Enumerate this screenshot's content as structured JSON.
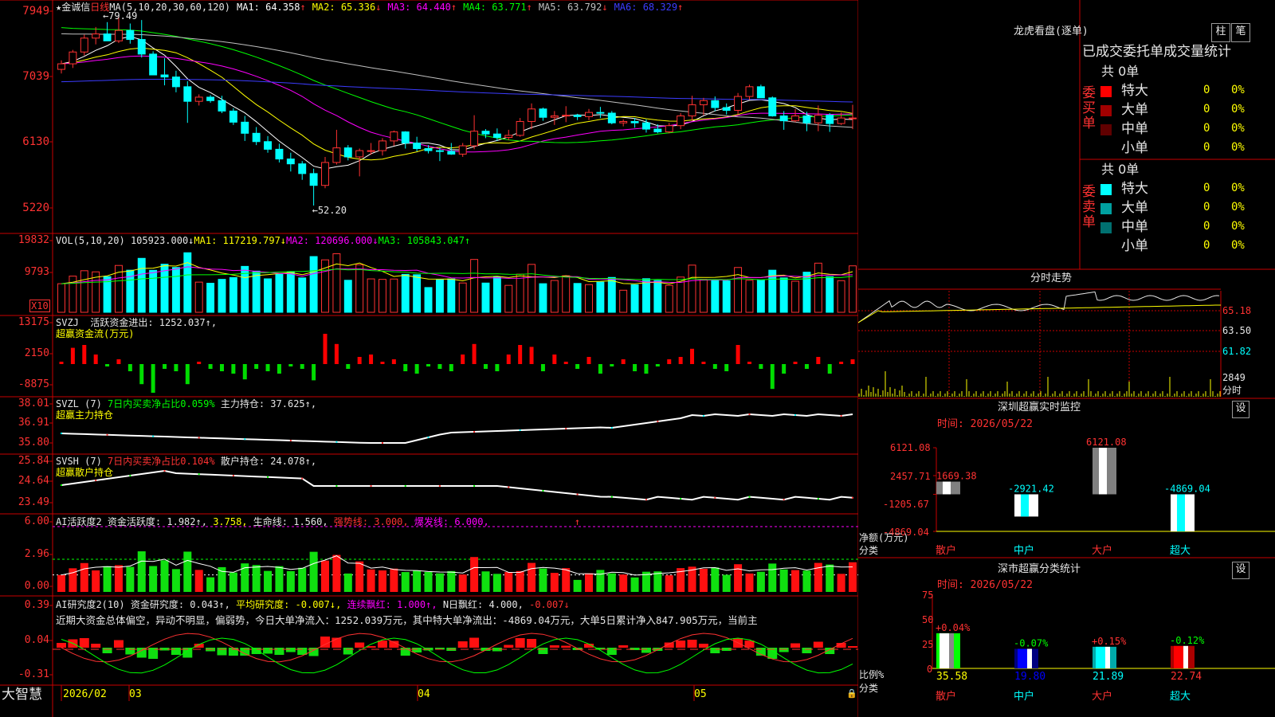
{
  "stock": {
    "star": "★",
    "name": "金诚信",
    "period": "日线"
  },
  "price_panel": {
    "ma_title": "MA(5,10,20,30,60,120)",
    "ma_items": [
      {
        "label": "MA1:",
        "value": "64.358",
        "arrow": "↑",
        "color": "#ffffff"
      },
      {
        "label": "MA2:",
        "value": "65.336",
        "arrow": "↓",
        "color": "#ffff00"
      },
      {
        "label": "MA3:",
        "value": "64.440",
        "arrow": "↑",
        "color": "#ff00ff"
      },
      {
        "label": "MA4:",
        "value": "63.771",
        "arrow": "↑",
        "color": "#00ff00"
      },
      {
        "label": "MA5:",
        "value": "63.792",
        "arrow": "↓",
        "color": "#c0c0c0"
      },
      {
        "label": "MA6:",
        "value": "68.329",
        "arrow": "↑",
        "color": "#3c3cff"
      }
    ],
    "yticks": [
      "7949",
      "7039",
      "6130",
      "5220"
    ],
    "high_label": "←79.49",
    "low_label": "←52.20"
  },
  "vol_panel": {
    "title": "VOL(5,10,20)",
    "value": "105923.000↓",
    "ma1": "MA1: 117219.797↓",
    "ma2": "MA2: 120696.000↓",
    "ma3": "MA3: 105843.047↑",
    "yticks": [
      "19832",
      "9793"
    ],
    "unit": "X10"
  },
  "svzj_panel": {
    "title": "SVZJ",
    "text": "活跃资金进出: 1252.037↑,",
    "subtitle": "超赢资金流(万元)",
    "yticks": [
      "13175",
      "2150",
      "-8875"
    ]
  },
  "svzl_panel": {
    "title": "SVZL (7)",
    "text1": "7日内买卖净占比0.059%",
    "text2": "主力持仓: 37.625↑,",
    "subtitle": "超赢主力持仓",
    "yticks": [
      "38.01",
      "36.91",
      "35.80"
    ]
  },
  "svsh_panel": {
    "title": "SVSH (7)",
    "text1": "7日内买卖净占比0.104%",
    "text2": "散户持仓: 24.078↑,",
    "subtitle": "超赢散户持仓",
    "yticks": [
      "25.84",
      "24.64",
      "23.49"
    ]
  },
  "ai_active_panel": {
    "title": "AI活跃度2",
    "a": "资金活跃度: 1.982↑,",
    "b": "3.758,",
    "c": "生命线: 1.560,",
    "d": "强势线: 3.000,",
    "e": "爆发线: 6.000,",
    "f": "↑",
    "yticks": [
      "6.00",
      "2.96",
      "0.00"
    ]
  },
  "ai_research_panel": {
    "title": "AI研究度2(10)",
    "a": "资金研究度: 0.043↑,",
    "b": "平均研究度: -0.007↓,",
    "c": "连续飘红: 1.000↑,",
    "d": "N日飘红: 4.000,",
    "e": "-0.007↓",
    "commentary": "近期大资金总体偏空，异动不明显，偏弱势，今日大单净流入：1252.039万元，其中特大单净流出：-4869.04万元，大单5日累计净入847.905万元，当前主",
    "yticks": [
      "0.39",
      "0.04",
      "-0.31"
    ]
  },
  "date_axis": {
    "brand": "大智慧",
    "labels": [
      "2026/02",
      "03",
      "04",
      "05"
    ]
  },
  "lhb": {
    "title": "龙虎看盘(逐单)",
    "btn1": "柱",
    "btn2": "笔",
    "header": "已成交委托单成交量统计",
    "buy_label": "委买单",
    "sell_label": "委卖单",
    "buy_total": "共 0单",
    "sell_total": "共 0单",
    "buy_rows": [
      {
        "name": "特大",
        "count": "0",
        "pct": "0%",
        "color": "#ff0000"
      },
      {
        "name": "大单",
        "count": "0",
        "pct": "0%",
        "color": "#a00000"
      },
      {
        "name": "中单",
        "count": "0",
        "pct": "0%",
        "color": "#600000"
      },
      {
        "name": "小单",
        "count": "0",
        "pct": "0%",
        "color": ""
      }
    ],
    "sell_rows": [
      {
        "name": "特大",
        "count": "0",
        "pct": "0%",
        "color": "#00ffff"
      },
      {
        "name": "大单",
        "count": "0",
        "pct": "0%",
        "color": "#00a0a0"
      },
      {
        "name": "中单",
        "count": "0",
        "pct": "0%",
        "color": "#007070"
      },
      {
        "name": "小单",
        "count": "0",
        "pct": "0%",
        "color": ""
      }
    ]
  },
  "intraday": {
    "title": "分时走势",
    "yticks": [
      "65.18",
      "63.50",
      "61.82"
    ],
    "vol_label": "2849",
    "vol_unit": "分时"
  },
  "monitor": {
    "title": "深圳超赢实时监控",
    "btn": "设",
    "time": "时间: 2026/05/22",
    "yticks": [
      "6121.08",
      "2457.71",
      "-1205.67",
      "-4869.04"
    ],
    "axis_label1": "净额(万元)",
    "axis_label2": "分类"
  },
  "classify": {
    "title": "深市超赢分类统计",
    "btn": "设",
    "time": "时间: 2026/05/22",
    "yticks": [
      "75",
      "50",
      "25",
      "0"
    ],
    "axis_label1": "比例%",
    "axis_label2": "分类"
  },
  "colors": {
    "up": "#ff3232",
    "down": "#00ffff",
    "frame": "#c80000",
    "accent": "#ffff00"
  },
  "chart_data": [
    {
      "type": "candlestick",
      "title": "金诚信 日线",
      "x_range": [
        "2026/02",
        "2026/05/22"
      ],
      "ohlc": [
        [
          71.8,
          73.1,
          71.2,
          72.6
        ],
        [
          72.6,
          74.6,
          72.0,
          74.3
        ],
        [
          74.3,
          76.8,
          73.8,
          76.3
        ],
        [
          76.3,
          77.9,
          75.4,
          76.9
        ],
        [
          76.9,
          78.6,
          75.9,
          75.9
        ],
        [
          75.9,
          79.5,
          75.6,
          77.4
        ],
        [
          77.4,
          78.4,
          75.5,
          76.1
        ],
        [
          76.1,
          78.9,
          73.5,
          74.0
        ],
        [
          74.0,
          74.4,
          71.0,
          71.0
        ],
        [
          71.0,
          73.4,
          69.5,
          70.7
        ],
        [
          70.7,
          71.6,
          68.5,
          69.3
        ],
        [
          69.3,
          70.1,
          64.1,
          67.2
        ],
        [
          67.2,
          68.2,
          66.6,
          67.8
        ],
        [
          67.8,
          68.1,
          67.0,
          67.3
        ],
        [
          67.3,
          68.0,
          65.5,
          65.8
        ],
        [
          65.8,
          66.2,
          63.8,
          64.2
        ],
        [
          64.2,
          65.1,
          61.5,
          62.6
        ],
        [
          62.6,
          63.5,
          60.9,
          61.4
        ],
        [
          61.4,
          62.2,
          59.8,
          60.3
        ],
        [
          60.3,
          61.1,
          58.4,
          58.9
        ],
        [
          58.9,
          59.8,
          57.1,
          58.2
        ],
        [
          58.2,
          58.6,
          55.9,
          56.8
        ],
        [
          56.8,
          57.5,
          52.2,
          55.1
        ],
        [
          55.1,
          59.2,
          54.7,
          58.4
        ],
        [
          58.4,
          63.1,
          58.1,
          60.5
        ],
        [
          60.5,
          60.9,
          58.7,
          59.2
        ],
        [
          59.2,
          60.4,
          56.4,
          60.1
        ],
        [
          60.1,
          61.2,
          59.5,
          60.1
        ],
        [
          60.1,
          61.9,
          59.4,
          61.5
        ],
        [
          61.5,
          63.0,
          60.8,
          62.8
        ],
        [
          62.8,
          62.9,
          60.4,
          61.2
        ],
        [
          61.2,
          62.1,
          60.0,
          60.4
        ],
        [
          60.4,
          60.9,
          59.7,
          60.1
        ],
        [
          60.1,
          60.5,
          58.6,
          60.0
        ],
        [
          60.0,
          61.2,
          59.5,
          59.6
        ],
        [
          59.6,
          61.2,
          59.2,
          60.8
        ],
        [
          60.8,
          65.2,
          60.3,
          62.9
        ],
        [
          62.9,
          63.2,
          61.9,
          62.5
        ],
        [
          62.5,
          63.3,
          61.5,
          62.0
        ],
        [
          62.0,
          63.1,
          61.6,
          62.3
        ],
        [
          62.3,
          64.8,
          62.1,
          64.3
        ],
        [
          64.3,
          66.9,
          63.2,
          66.1
        ],
        [
          66.1,
          66.3,
          64.4,
          64.9
        ],
        [
          64.9,
          65.8,
          63.8,
          65.1
        ],
        [
          65.1,
          66.5,
          64.2,
          65.2
        ],
        [
          65.2,
          65.4,
          64.5,
          65.0
        ],
        [
          65.0,
          66.1,
          64.5,
          65.6
        ],
        [
          65.6,
          66.4,
          64.8,
          65.5
        ],
        [
          65.5,
          65.8,
          63.9,
          64.1
        ],
        [
          64.1,
          64.6,
          63.6,
          64.3
        ],
        [
          64.3,
          64.8,
          63.4,
          64.1
        ],
        [
          64.1,
          64.6,
          62.7,
          63.2
        ],
        [
          63.2,
          63.9,
          62.6,
          62.8
        ],
        [
          62.8,
          64.1,
          62.6,
          63.7
        ],
        [
          63.7,
          65.5,
          63.2,
          65.1
        ],
        [
          65.1,
          68.0,
          64.4,
          66.7
        ],
        [
          66.7,
          67.7,
          65.2,
          67.3
        ],
        [
          67.3,
          67.9,
          65.8,
          66.3
        ],
        [
          66.3,
          66.9,
          65.3,
          65.9
        ],
        [
          65.9,
          68.4,
          65.3,
          67.9
        ],
        [
          67.9,
          69.6,
          67.4,
          69.3
        ],
        [
          69.3,
          69.6,
          67.7,
          67.7
        ],
        [
          67.7,
          67.9,
          65.0,
          65.1
        ],
        [
          65.1,
          65.8,
          63.1,
          64.4
        ],
        [
          64.4,
          66.1,
          64.2,
          65.1
        ],
        [
          65.1,
          65.7,
          62.9,
          64.1
        ],
        [
          64.1,
          66.6,
          62.9,
          65.2
        ],
        [
          65.2,
          65.5,
          62.8,
          64.0
        ],
        [
          64.0,
          65.6,
          63.8,
          64.8
        ],
        [
          64.8,
          66.7,
          63.2,
          64.8
        ]
      ],
      "ylim": [
        52.2,
        79.49
      ],
      "ma_series": [
        "MA1",
        "MA2",
        "MA3",
        "MA4",
        "MA5",
        "MA6"
      ]
    },
    {
      "type": "bar",
      "title": "VOL(5,10,20)",
      "ylim": [
        0,
        19832
      ]
    },
    {
      "type": "bar",
      "title": "SVZJ 超赢资金流(万元)",
      "ylim": [
        -8875,
        13175
      ]
    },
    {
      "type": "line",
      "title": "SVZL 超赢主力持仓",
      "ylim": [
        35.8,
        38.01
      ]
    },
    {
      "type": "line",
      "title": "SVSH 超赢散户持仓",
      "ylim": [
        23.49,
        25.84
      ]
    },
    {
      "type": "bar",
      "title": "AI活跃度2",
      "ylim": [
        0,
        6
      ]
    },
    {
      "type": "bar",
      "title": "AI研究度2(10)",
      "ylim": [
        -0.31,
        0.39
      ]
    },
    {
      "type": "line",
      "title": "分时走势",
      "ylim": [
        61.82,
        65.18
      ]
    },
    {
      "type": "bar",
      "title": "深圳超赢实时监控",
      "categories": [
        "散户",
        "中户",
        "大户",
        "超大"
      ],
      "values": [
        1669.38,
        -2921.42,
        6121.08,
        -4869.04
      ],
      "labels": [
        "1669.38",
        "-2921.42",
        "6121.08",
        "-4869.04"
      ],
      "ylim": [
        -4869.04,
        6121.08
      ]
    },
    {
      "type": "bar",
      "title": "深市超赢分类统计",
      "categories": [
        "散户",
        "中户",
        "大户",
        "超大"
      ],
      "values": [
        35.58,
        19.8,
        21.89,
        22.74
      ],
      "change_labels": [
        "+0.04%",
        "-0.07%",
        "+0.15%",
        "-0.12%"
      ],
      "ylim": [
        0,
        75
      ]
    }
  ]
}
